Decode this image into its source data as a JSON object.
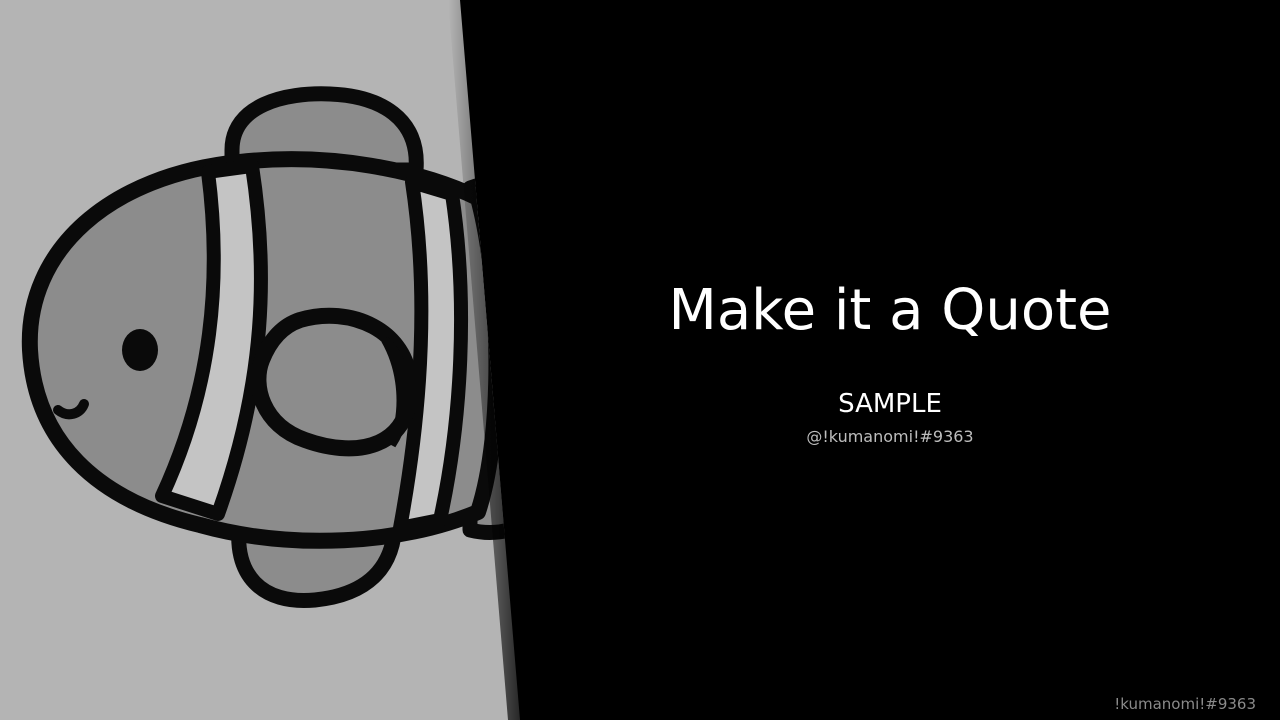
{
  "quote": {
    "text": "Make it a Quote",
    "author_name": "SAMPLE",
    "author_handle": "@!kumanomi!#9363"
  },
  "watermark": {
    "text": "!kumanomi!#9363"
  },
  "avatar": {
    "icon": "clownfish-icon"
  },
  "colors": {
    "background": "#000000",
    "avatar_bg": "#b4b4b4",
    "fish_fill": "#8c8c8c",
    "fish_stripe": "#c4c4c4",
    "outline": "#0a0a0a",
    "quote_text": "#ffffff",
    "handle_text": "#bdbdbd",
    "watermark_text": "#8a8a8a"
  }
}
